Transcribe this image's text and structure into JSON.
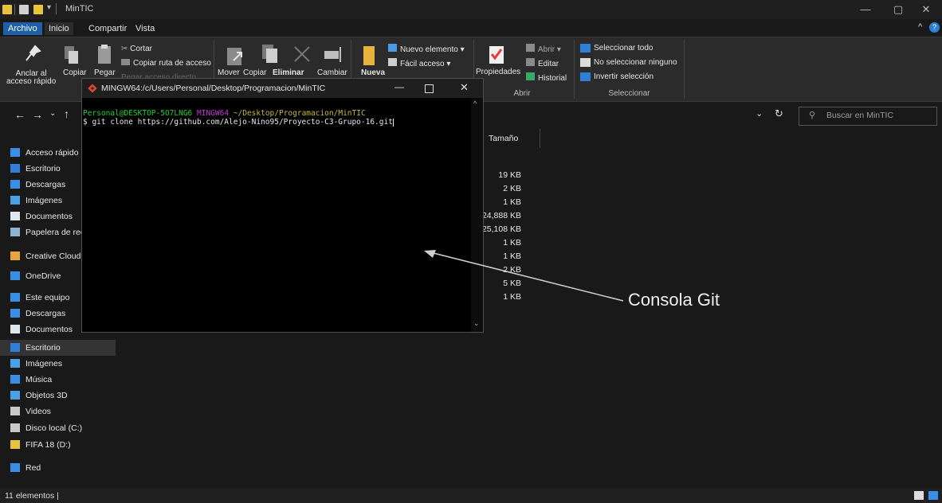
{
  "window": {
    "title": "MinTIC",
    "controls": [
      "—",
      "▢",
      "✕"
    ]
  },
  "ribbon": {
    "tabs": [
      "Archivo",
      "Inicio",
      "Compartir",
      "Vista"
    ],
    "portapapeles": {
      "anclar": "Anclar al\nacceso rápido",
      "copiar": "Copiar",
      "pegar": "Pegar",
      "cortar": "Cortar",
      "copiar_ruta": "Copiar ruta de acceso",
      "pegar_acceso": "Pegar acceso directo"
    },
    "organizar": {
      "mover": "Mover",
      "copiar": "Copiar",
      "eliminar": "Eliminar",
      "cambiar": "Cambiar"
    },
    "nuevo": {
      "nueva": "Nueva",
      "nuevo_elemento": "Nuevo elemento ▾",
      "facil_acceso": "Fácil acceso ▾"
    },
    "abrir": {
      "propiedades": "Propiedades",
      "abrir": "Abrir ▾",
      "editar": "Editar",
      "historial": "Historial",
      "group_label": "Abrir"
    },
    "seleccionar": {
      "todo": "Seleccionar todo",
      "ninguno": "No seleccionar ninguno",
      "invertir": "Invertir selección",
      "group_label": "Seleccionar"
    }
  },
  "address": {
    "search_placeholder": "Buscar en MinTIC"
  },
  "nav": [
    {
      "label": "Acceso rápido",
      "icon": "star-icon",
      "color": "#3a8ee6"
    },
    {
      "label": "Escritorio",
      "icon": "desktop-folder-icon",
      "color": "#2f7fd6"
    },
    {
      "label": "Descargas",
      "icon": "download-arrow-icon",
      "color": "#3a8ee6"
    },
    {
      "label": "Imágenes",
      "icon": "images-folder-icon",
      "color": "#4aa0e8"
    },
    {
      "label": "Documentos",
      "icon": "documents-icon",
      "color": "#dfe6ee"
    },
    {
      "label": "Papelera de reciclaje",
      "icon": "recycle-bin-icon",
      "color": "#8fb3d0"
    },
    {
      "label": "Creative Cloud Files",
      "icon": "creative-cloud-icon",
      "color": "#e8a33a"
    },
    {
      "label": "OneDrive",
      "icon": "cloud-icon",
      "color": "#3a8ee6"
    },
    {
      "label": "Este equipo",
      "icon": "computer-icon",
      "color": "#3a8ee6"
    },
    {
      "label": "Descargas",
      "icon": "download-arrow-icon",
      "color": "#3a8ee6"
    },
    {
      "label": "Documentos",
      "icon": "documents-icon",
      "color": "#dfe6ee"
    },
    {
      "label": "Escritorio",
      "icon": "desktop-folder-icon",
      "color": "#2f7fd6"
    },
    {
      "label": "Imágenes",
      "icon": "images-folder-icon",
      "color": "#4aa0e8"
    },
    {
      "label": "Música",
      "icon": "music-note-icon",
      "color": "#3a8ee6"
    },
    {
      "label": "Objetos 3D",
      "icon": "cube-3d-icon",
      "color": "#4aa0e8"
    },
    {
      "label": "Videos",
      "icon": "video-icon",
      "color": "#c8c8c8"
    },
    {
      "label": "Disco local (C:)",
      "icon": "drive-icon",
      "color": "#c8c8c8"
    },
    {
      "label": "FIFA 18 (D:)",
      "icon": "fifa-drive-icon",
      "color": "#e8c43a"
    },
    {
      "label": "Red",
      "icon": "network-icon",
      "color": "#3a8ee6"
    }
  ],
  "files": {
    "column_header": "Tamaño",
    "sizes": [
      "19 KB",
      "2 KB",
      "1 KB",
      "24,888 KB",
      "25,108 KB",
      "1 KB",
      "1 KB",
      "2 KB",
      "5 KB",
      "1 KB"
    ]
  },
  "status": {
    "count": "11 elementos  |"
  },
  "terminal": {
    "title": "MINGW64:/c/Users/Personal/Desktop/Programacion/MinTIC",
    "prompt_user": "Personal@DESKTOP-5O7LNG6",
    "prompt_env": "MINGW64",
    "prompt_path": "~/Desktop/Programacion/MinTIC",
    "command": "$ git clone https://github.com/Alejo-Nino95/Proyecto-C3-Grupo-16.git"
  },
  "annotation": {
    "label": "Consola Git"
  },
  "colors": {
    "accent": "#1e5fa8",
    "prompt_green": "#1fd135",
    "prompt_magenta": "#c23bd6",
    "prompt_yellow": "#c8b93a"
  }
}
